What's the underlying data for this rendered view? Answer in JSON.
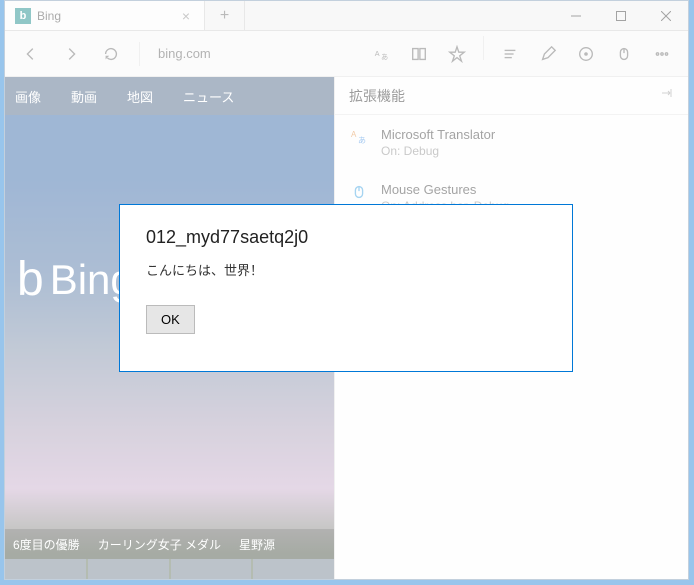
{
  "tab": {
    "title": "Bing",
    "icon_letter": "b"
  },
  "url": "bing.com",
  "nav": {
    "images": "画像",
    "video": "動画",
    "map": "地図",
    "news": "ニュース"
  },
  "logo": "Bing",
  "captions": {
    "c1": "6度目の優勝",
    "c2": "カーリング女子 メダル",
    "c3": "星野源"
  },
  "sidebar": {
    "title": "拡張機能",
    "ext1": {
      "name": "Microsoft Translator",
      "status": "On: Debug"
    },
    "ext2": {
      "name": "Mouse Gestures",
      "status": "On: Address bar, Debug"
    }
  },
  "dialog": {
    "title": "012_myd77saetq2j0",
    "message": "こんにちは、世界！",
    "ok": "OK"
  }
}
